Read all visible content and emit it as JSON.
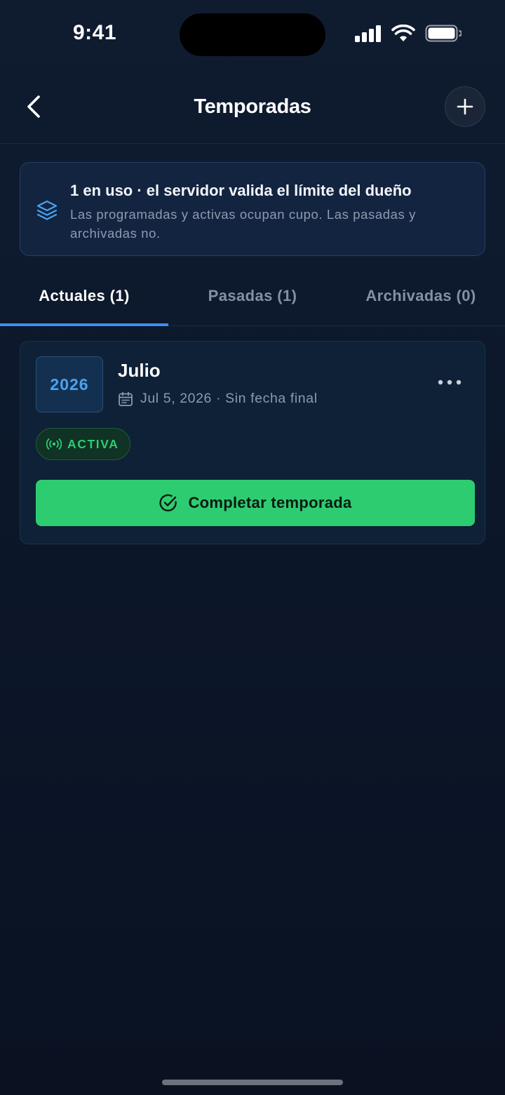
{
  "status_bar": {
    "time": "9:41"
  },
  "header": {
    "title": "Temporadas",
    "back_icon": "chevron-left-icon",
    "add_icon": "plus-icon"
  },
  "info_banner": {
    "icon": "layers-icon",
    "title": "1 en uso · el servidor valida el límite del dueño",
    "description": "Las programadas y activas ocupan cupo. Las pasadas y archivadas no."
  },
  "tabs": [
    {
      "label": "Actuales (1)",
      "active": true
    },
    {
      "label": "Pasadas (1)",
      "active": false
    },
    {
      "label": "Archivadas (0)",
      "active": false
    }
  ],
  "season": {
    "year": "2026",
    "name": "Julio",
    "dates": "Jul 5, 2026 · Sin fecha final",
    "status": "ACTIVA",
    "action_label": "Completar temporada"
  },
  "colors": {
    "background": "#0c172a",
    "accent_blue": "#3b8df2",
    "success_green": "#2ecc71",
    "banner_bg": "#132440",
    "card_bg": "#0f2136"
  }
}
